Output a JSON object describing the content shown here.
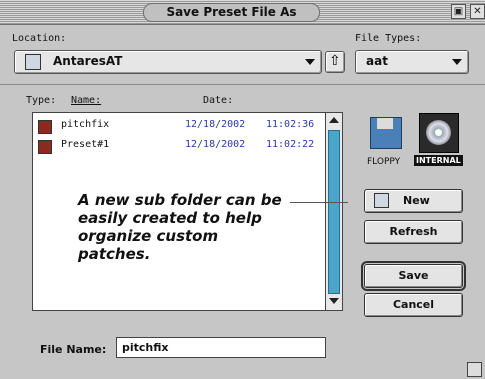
{
  "window": {
    "title": "Save Preset File As"
  },
  "location": {
    "label": "Location:",
    "value": "AntaresAT"
  },
  "file_types": {
    "label": "File Types:",
    "value": "aat"
  },
  "list": {
    "headers": {
      "type": "Type:",
      "name": "Name:",
      "date": "Date:"
    },
    "rows": [
      {
        "name": "pitchfix",
        "date": "12/18/2002",
        "time": "11:02:36"
      },
      {
        "name": "Preset#1",
        "date": "12/18/2002",
        "time": "11:02:22"
      }
    ]
  },
  "drives": [
    {
      "label": "FLOPPY",
      "icon": "floppy-icon"
    },
    {
      "label": "INTERNAL",
      "icon": "cd-icon"
    }
  ],
  "buttons": {
    "new": "New",
    "refresh": "Refresh",
    "save": "Save",
    "cancel": "Cancel"
  },
  "annotation": "A new sub folder can be easily created to help organize custom patches.",
  "file_name": {
    "label": "File Name:",
    "value": "pitchfix"
  }
}
